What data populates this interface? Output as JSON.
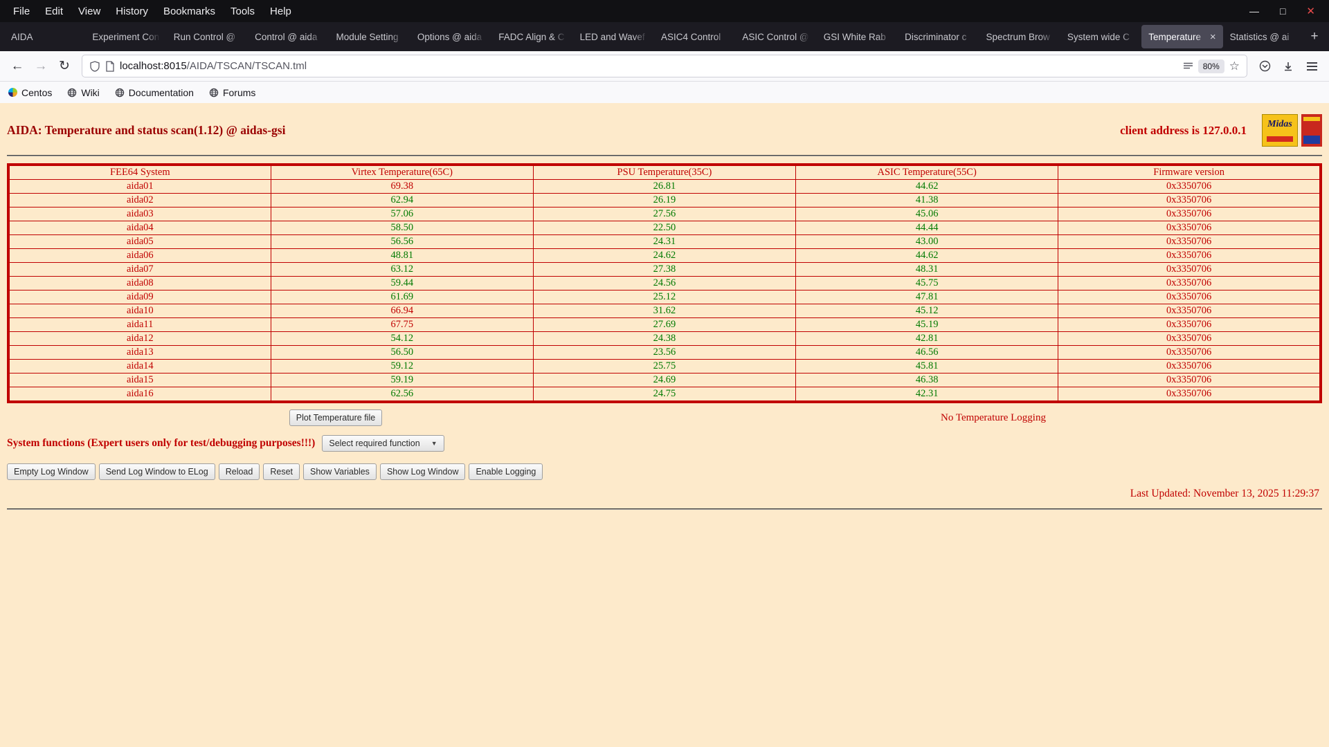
{
  "theme": {
    "page_bg": "#fdeacb",
    "red": "#c00000",
    "dark_red": "#9a0000",
    "green": "#007a00"
  },
  "browser": {
    "menu_items": [
      "File",
      "Edit",
      "View",
      "History",
      "Bookmarks",
      "Tools",
      "Help"
    ],
    "icons": {
      "minimize": "—",
      "maximize": "□",
      "close": "✕",
      "back": "←",
      "forward": "→",
      "reload": "↻",
      "new_tab": "+",
      "tab_close": "×",
      "star": "☆",
      "select_arrow": "▼"
    },
    "tabs": [
      {
        "label": "AIDA",
        "active": false
      },
      {
        "label": "Experiment Con",
        "active": false
      },
      {
        "label": "Run Control @",
        "active": false
      },
      {
        "label": "Control @ aida",
        "active": false
      },
      {
        "label": "Module Setting",
        "active": false
      },
      {
        "label": "Options @ aida",
        "active": false
      },
      {
        "label": "FADC Align & C",
        "active": false
      },
      {
        "label": "LED and Wavef",
        "active": false
      },
      {
        "label": "ASIC4 Control",
        "active": false
      },
      {
        "label": "ASIC Control @",
        "active": false
      },
      {
        "label": "GSI White Rab",
        "active": false
      },
      {
        "label": "Discriminator c",
        "active": false
      },
      {
        "label": "Spectrum Brow",
        "active": false
      },
      {
        "label": "System wide C",
        "active": false
      },
      {
        "label": "Temperature",
        "active": true
      },
      {
        "label": "Statistics @ ai",
        "active": false
      }
    ],
    "nav": {
      "url_domain": "localhost:8015",
      "url_path": "/AIDA/TSCAN/TSCAN.tml",
      "zoom_badge": "80%"
    },
    "bookmarks": [
      "Centos",
      "Wiki",
      "Documentation",
      "Forums"
    ]
  },
  "page": {
    "title": "AIDA: Temperature and status scan(1.12) @ aidas-gsi",
    "client_address": "client address is 127.0.0.1",
    "logos": {
      "midas": "Midas"
    },
    "table": {
      "headers": [
        "FEE64 System",
        "Virtex Temperature(65C)",
        "PSU Temperature(35C)",
        "ASIC Temperature(55C)",
        "Firmware version"
      ],
      "limits": {
        "virtex": 65,
        "psu": 35,
        "asic": 55
      },
      "rows": [
        {
          "name": "aida01",
          "virtex": "69.38",
          "psu": "26.81",
          "asic": "44.62",
          "firmware": "0x3350706"
        },
        {
          "name": "aida02",
          "virtex": "62.94",
          "psu": "26.19",
          "asic": "41.38",
          "firmware": "0x3350706"
        },
        {
          "name": "aida03",
          "virtex": "57.06",
          "psu": "27.56",
          "asic": "45.06",
          "firmware": "0x3350706"
        },
        {
          "name": "aida04",
          "virtex": "58.50",
          "psu": "22.50",
          "asic": "44.44",
          "firmware": "0x3350706"
        },
        {
          "name": "aida05",
          "virtex": "56.56",
          "psu": "24.31",
          "asic": "43.00",
          "firmware": "0x3350706"
        },
        {
          "name": "aida06",
          "virtex": "48.81",
          "psu": "24.62",
          "asic": "44.62",
          "firmware": "0x3350706"
        },
        {
          "name": "aida07",
          "virtex": "63.12",
          "psu": "27.38",
          "asic": "48.31",
          "firmware": "0x3350706"
        },
        {
          "name": "aida08",
          "virtex": "59.44",
          "psu": "24.56",
          "asic": "45.75",
          "firmware": "0x3350706"
        },
        {
          "name": "aida09",
          "virtex": "61.69",
          "psu": "25.12",
          "asic": "47.81",
          "firmware": "0x3350706"
        },
        {
          "name": "aida10",
          "virtex": "66.94",
          "psu": "31.62",
          "asic": "45.12",
          "firmware": "0x3350706"
        },
        {
          "name": "aida11",
          "virtex": "67.75",
          "psu": "27.69",
          "asic": "45.19",
          "firmware": "0x3350706"
        },
        {
          "name": "aida12",
          "virtex": "54.12",
          "psu": "24.38",
          "asic": "42.81",
          "firmware": "0x3350706"
        },
        {
          "name": "aida13",
          "virtex": "56.50",
          "psu": "23.56",
          "asic": "46.56",
          "firmware": "0x3350706"
        },
        {
          "name": "aida14",
          "virtex": "59.12",
          "psu": "25.75",
          "asic": "45.81",
          "firmware": "0x3350706"
        },
        {
          "name": "aida15",
          "virtex": "59.19",
          "psu": "24.69",
          "asic": "46.38",
          "firmware": "0x3350706"
        },
        {
          "name": "aida16",
          "virtex": "62.56",
          "psu": "24.75",
          "asic": "42.31",
          "firmware": "0x3350706"
        }
      ]
    },
    "plot_button": "Plot Temperature file",
    "logging_status": "No Temperature Logging",
    "system_functions_label": "System functions (Expert users only for test/debugging purposes!!!)",
    "function_select_value": "Select required function",
    "action_buttons": [
      "Empty Log Window",
      "Send Log Window to ELog",
      "Reload",
      "Reset",
      "Show Variables",
      "Show Log Window",
      "Enable Logging"
    ],
    "last_updated": "Last Updated: November 13, 2025 11:29:37"
  }
}
